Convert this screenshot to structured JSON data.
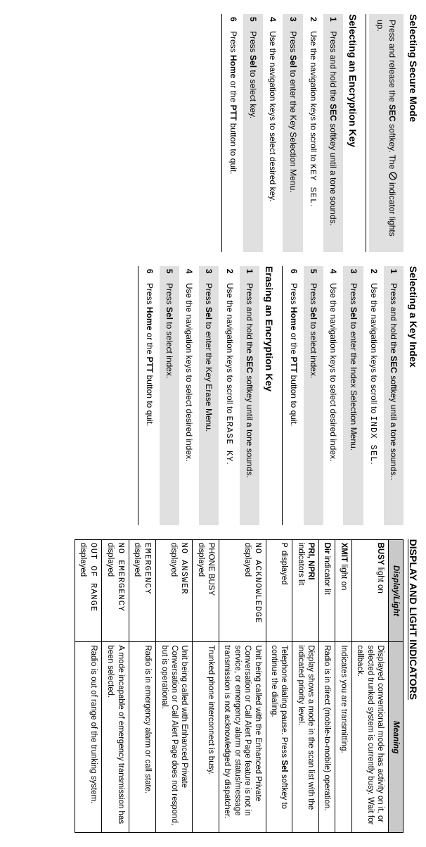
{
  "col1": {
    "h1": "Selecting Secure Mode",
    "block1_pre": "Press and release the ",
    "block1_sec": "SEC",
    "block1_mid": " softkey. The ",
    "block1_post": " indicator lights up.",
    "h2": "Selecting an Encryption Key",
    "steps": [
      {
        "pre": "Press and hold the ",
        "b1": "SEC",
        "post": " softkey until a tone sounds."
      },
      {
        "pre": "Use the navigation keys to scroll to ",
        "mono": "KEY SEL",
        "post": "."
      },
      {
        "pre": "Press ",
        "b1": "Sel",
        "post": " to enter the Key Selection Menu."
      },
      {
        "pre": "Use the navigation keys to select desired key."
      },
      {
        "pre": "Press ",
        "b1": "Sel",
        "post": " to select key."
      },
      {
        "pre": "Press ",
        "b1": "Home",
        "mid": " or the ",
        "b2": "PTT",
        "post": " button to quit."
      }
    ]
  },
  "col2": {
    "h1": "Selecting a Key Index",
    "steps1": [
      {
        "pre": "Press and hold the ",
        "b1": "SEC",
        "post": " softkey until a tone sounds.."
      },
      {
        "pre": "Use the navigation keys to scroll to ",
        "mono": "INDX SEL",
        "post": "."
      },
      {
        "pre": "Press ",
        "b1": "Sel",
        "post": " to enter the Index Selection Menu."
      },
      {
        "pre": "Use the navigation keys to select desired index."
      },
      {
        "pre": "Press ",
        "b1": "Sel",
        "post": " to select index."
      },
      {
        "pre": "Press ",
        "b1": "Home",
        "mid": " or the ",
        "b2": "PTT",
        "post": " button to quit."
      }
    ],
    "h2": "Erasing an Encryption Key",
    "steps2": [
      {
        "pre": "Press and hold the ",
        "b1": "SEC",
        "post": " softkey until a tone sounds."
      },
      {
        "pre": "Use the navigation keys to scroll to ",
        "mono": "ERASE KY",
        "post": "."
      },
      {
        "pre": "Press ",
        "b1": "Sel",
        "post": " to enter the Key Erase Menu."
      },
      {
        "pre": "Use the navigation keys to select desired index."
      },
      {
        "pre": "Press ",
        "b1": "Sel",
        "post": " to select index."
      },
      {
        "pre": "Press ",
        "b1": "Home",
        "mid": " or the ",
        "b2": "PTT",
        "post": " button to quit."
      }
    ]
  },
  "col3": {
    "title": "DISPLAY AND LIGHT INDICATORS",
    "th1": "Display/Light",
    "th2": "Meaning",
    "rows": [
      {
        "d_b": "BUSY",
        "d_post": " light on",
        "m": "Displayed conventional mode has activity on it, or selected trunked system is currently busy. Wait for callback."
      },
      {
        "d_b": "XMIT",
        "d_post": " light on",
        "m": "Indicates you are transmitting."
      },
      {
        "d_b": "Dir",
        "d_post": " indicator lit",
        "m": "Radio is in direct (mobile-to-mobile) operation."
      },
      {
        "d_b": "PRI, NPRI",
        "d_post2_pre": "",
        "d_post2": "indicators lit",
        "m": "Display shows a mode in the scan list with the indicated priority level."
      },
      {
        "d_mono": "P",
        "d_post": " displayed",
        "m_pre": "Telephone dialing pause. Press ",
        "m_b": "Sel",
        "m_post": " softkey to continue the dialing."
      },
      {
        "d_mono": "NO ACKNOWLEDGE",
        "d_post2": "displayed",
        "m": "Unit being called with the Enhanced Private Conversation or Call Alert Page feature is not in service, or emergency alarm or status/message transmission is not acknowledged by dispatcher."
      },
      {
        "d_pre": "PHONE BUSY",
        "d_post2": "displayed",
        "m": "Trunked phone interconnect is busy."
      },
      {
        "d_mono": "NO ANSWER",
        "d_post2": "displayed",
        "m": "Unit being called with Enhanced Private Conversation or Call Alert Page does not respond, but is operational."
      },
      {
        "d_mono": "EMERGENCY",
        "d_post2": "displayed",
        "m": "Radio is in emergency alarm or call state."
      },
      {
        "d_mono": "NO EMERGENCY",
        "d_post2": "displayed",
        "m": "A mode incapable of emergency transmission has been selected."
      },
      {
        "d_mono": "OUT OF RANGE",
        "d_post2": "displayed",
        "m": "Radio is out of range of the trunking system."
      }
    ]
  }
}
